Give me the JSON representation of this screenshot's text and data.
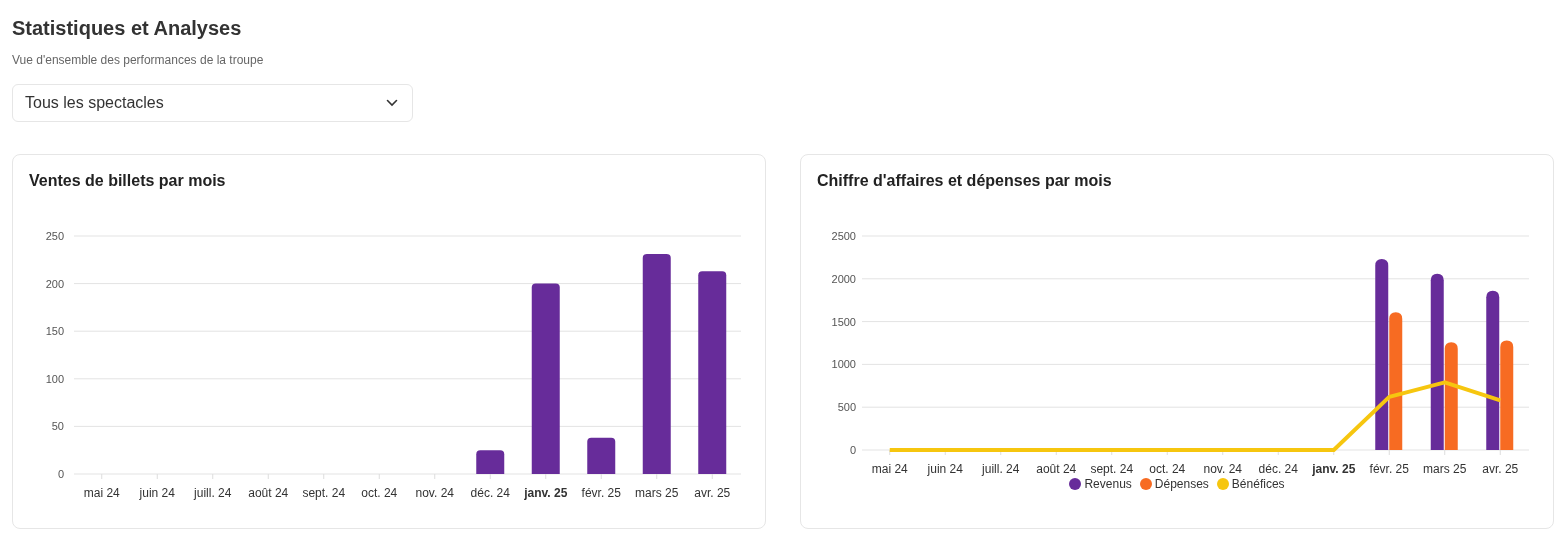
{
  "header": {
    "title": "Statistiques et Analyses",
    "subtitle": "Vue d'ensemble des performances de la troupe"
  },
  "filter": {
    "value": "Tous les spectacles"
  },
  "cards": [
    {
      "title": "Ventes de billets par mois",
      "chart_data": {
        "type": "bar",
        "categories": [
          "mai 24",
          "juin 24",
          "juill. 24",
          "août 24",
          "sept. 24",
          "oct. 24",
          "nov. 24",
          "déc. 24",
          "janv. 25",
          "févr. 25",
          "mars 25",
          "avr. 25"
        ],
        "values": [
          0,
          0,
          0,
          0,
          0,
          0,
          0,
          25,
          200,
          38,
          231,
          213
        ],
        "ylim": [
          0,
          250
        ],
        "yticks": [
          0,
          50,
          100,
          150,
          200,
          250
        ],
        "color": "#672c9a",
        "grid": true,
        "annotations": [
          {
            "x": "janv. 25"
          }
        ]
      }
    },
    {
      "title": "Chiffre d'affaires et dépenses par mois",
      "chart_data": {
        "type": "bar",
        "categories": [
          "mai 24",
          "juin 24",
          "juill. 24",
          "août 24",
          "sept. 24",
          "oct. 24",
          "nov. 24",
          "déc. 24",
          "janv. 25",
          "févr. 25",
          "mars 25",
          "avr. 25"
        ],
        "series": [
          {
            "name": "Revenus",
            "color": "#672c9a",
            "type": "bar",
            "values": [
              0,
              0,
              0,
              0,
              0,
              0,
              0,
              0,
              0,
              2230,
              2060,
              1860
            ]
          },
          {
            "name": "Dépenses",
            "color": "#f76b22",
            "type": "bar",
            "values": [
              0,
              0,
              0,
              0,
              0,
              0,
              0,
              0,
              0,
              1610,
              1260,
              1280
            ]
          },
          {
            "name": "Bénéfices",
            "color": "#f6c60f",
            "type": "line",
            "values": [
              0,
              0,
              0,
              0,
              0,
              0,
              0,
              0,
              0,
              620,
              790,
              580
            ]
          }
        ],
        "ylim": [
          0,
          2500
        ],
        "yticks": [
          0,
          500,
          1000,
          1500,
          2000,
          2500
        ],
        "stacked": false,
        "grid": true,
        "annotations": [
          {
            "x": "janv. 25"
          }
        ]
      }
    }
  ]
}
